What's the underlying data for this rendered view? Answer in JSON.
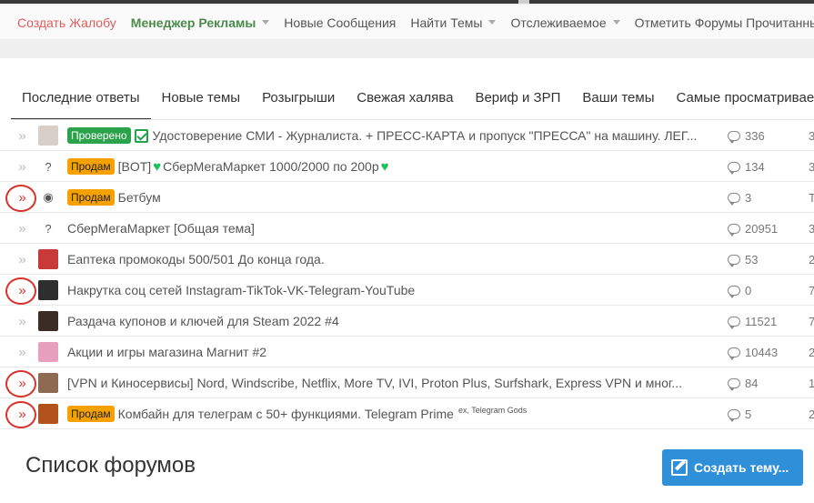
{
  "nav": [
    {
      "label": "Создать Жалобу",
      "style": "red",
      "dropdown": false
    },
    {
      "label": "Менеджер Рекламы",
      "style": "green",
      "dropdown": true
    },
    {
      "label": "Новые Сообщения",
      "style": "",
      "dropdown": false
    },
    {
      "label": "Найти Темы",
      "style": "",
      "dropdown": true
    },
    {
      "label": "Отслеживаемое",
      "style": "",
      "dropdown": true
    },
    {
      "label": "Отметить Форумы Прочитанными",
      "style": "",
      "dropdown": false
    }
  ],
  "tabs": [
    {
      "label": "Последние ответы",
      "active": true
    },
    {
      "label": "Новые темы",
      "active": false
    },
    {
      "label": "Розыгрыши",
      "active": false
    },
    {
      "label": "Свежая халява",
      "active": false
    },
    {
      "label": "Вериф и ЗРП",
      "active": false
    },
    {
      "label": "Ваши темы",
      "active": false
    },
    {
      "label": "Самые просматриваемые",
      "active": false
    }
  ],
  "threads": [
    {
      "unread": false,
      "avatar": "cat-avatar",
      "avatar_text": "",
      "avatar_color": "#d8cfc8",
      "prefix": "Проверено",
      "prefix_style": "green",
      "check": true,
      "title": "Удостоверение СМИ - Журналиста. + ПРЕСС-КАРТА и пропуск \"ПРЕССА\" на машину. ЛЕГ...",
      "replies": "336",
      "edge": "3"
    },
    {
      "unread": false,
      "avatar": "unknown-avatar",
      "avatar_text": "?",
      "avatar_color": "#ffffff",
      "prefix": "Продам",
      "prefix_style": "orange",
      "check": false,
      "title_parts": [
        "[BOT] ",
        "♥",
        " СберМегаМаркет 1000/2000 по 200р ",
        "♥"
      ],
      "replies": "134",
      "edge": "3"
    },
    {
      "unread": true,
      "avatar": "logo-avatar",
      "avatar_text": "◉",
      "avatar_color": "#ffffff",
      "prefix": "Продам",
      "prefix_style": "orange",
      "check": false,
      "title": "Бетбум",
      "replies": "3",
      "edge": "T"
    },
    {
      "unread": false,
      "avatar": "unknown-avatar",
      "avatar_text": "?",
      "avatar_color": "#ffffff",
      "prefix": "",
      "prefix_style": "",
      "check": false,
      "title": "СберМегаМаркет [Общая тема]",
      "replies": "20951",
      "edge": "3"
    },
    {
      "unread": false,
      "avatar": "octopus-avatar",
      "avatar_text": "",
      "avatar_color": "#c83a3a",
      "prefix": "",
      "prefix_style": "",
      "check": false,
      "title": "Еаптека промокоды 500/501 До конца года.",
      "replies": "53",
      "edge": "2"
    },
    {
      "unread": true,
      "avatar": "dark-photo-avatar",
      "avatar_text": "",
      "avatar_color": "#2e2e2e",
      "prefix": "",
      "prefix_style": "",
      "check": false,
      "title": "Накрутка соц сетей Instagram-TikTok-VK-Telegram-YouTube",
      "replies": "0",
      "edge": "7"
    },
    {
      "unread": false,
      "avatar": "character-avatar",
      "avatar_text": "",
      "avatar_color": "#3b2d25",
      "prefix": "",
      "prefix_style": "",
      "check": false,
      "title": "Раздача купонов и ключей для Steam 2022 #4",
      "replies": "11521",
      "edge": "7"
    },
    {
      "unread": false,
      "avatar": "flowers-avatar",
      "avatar_text": "",
      "avatar_color": "#e8a0bf",
      "prefix": "",
      "prefix_style": "",
      "check": false,
      "title": "Акции и игры магазина Магнит #2",
      "replies": "10443",
      "edge": "2"
    },
    {
      "unread": true,
      "avatar": "collage-avatar",
      "avatar_text": "",
      "avatar_color": "#8f6a52",
      "prefix": "",
      "prefix_style": "",
      "check": false,
      "title": "[VPN и Киносервисы] Nord, Windscribe, Netflix, More TV, IVI, Proton Plus, Surfshark, Express VPN и мног...",
      "replies": "84",
      "edge": "1"
    },
    {
      "unread": true,
      "avatar": "sunset-avatar",
      "avatar_text": "",
      "avatar_color": "#b4521c",
      "prefix": "Продам",
      "prefix_style": "orange",
      "check": false,
      "title": "Комбайн для телеграм с 50+ функциями. Telegram Prime",
      "tags": "ex, Telegram Gods",
      "replies": "5",
      "edge": "2"
    }
  ],
  "forums_heading": "Список форумов",
  "create_button": "Создать тему...",
  "colors": {
    "unread_ring": "#d9312b",
    "prefix_green": "#2aa34a",
    "prefix_orange": "#f5a100",
    "button_blue": "#2f8fd8",
    "heart_green": "#19c15a"
  }
}
